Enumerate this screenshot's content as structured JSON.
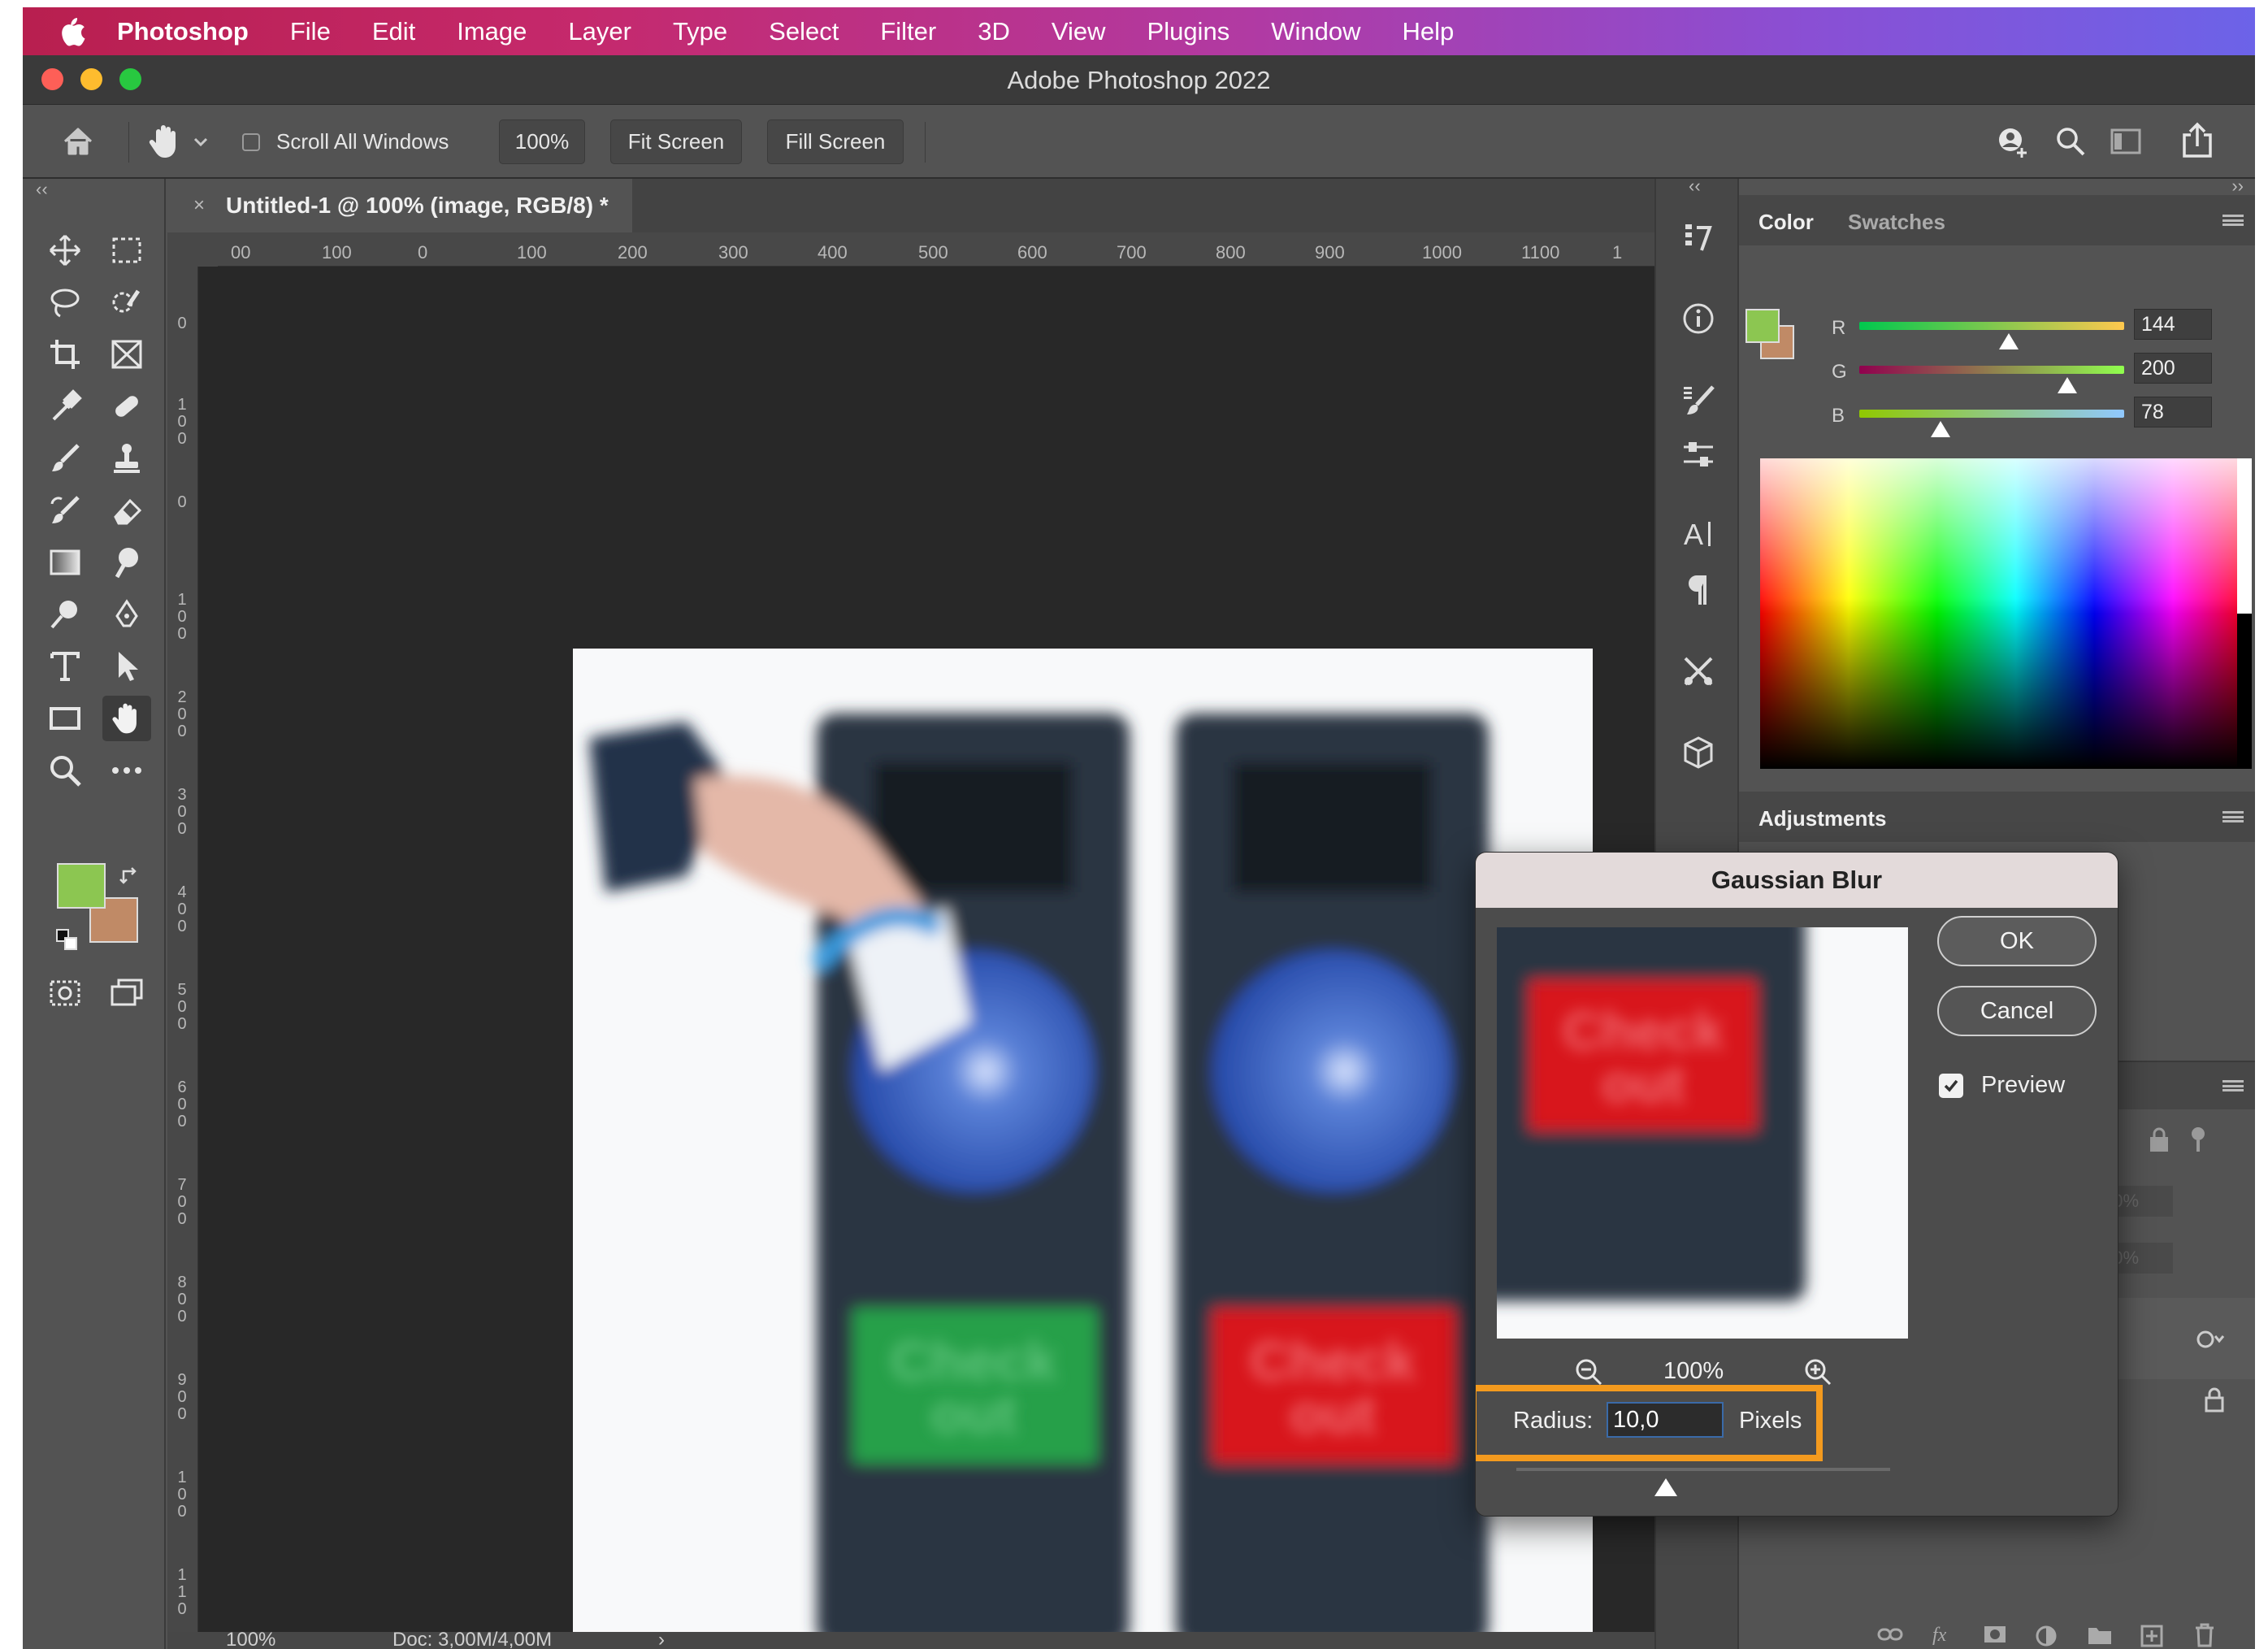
{
  "menubar": {
    "app_name": "Photoshop",
    "items": [
      "File",
      "Edit",
      "Image",
      "Layer",
      "Type",
      "Select",
      "Filter",
      "3D",
      "View",
      "Plugins",
      "Window",
      "Help"
    ]
  },
  "window": {
    "title": "Adobe Photoshop 2022"
  },
  "options_bar": {
    "scroll_all_windows_label": "Scroll All Windows",
    "scroll_all_windows_checked": false,
    "zoom_value": "100%",
    "fit_screen_label": "Fit Screen",
    "fill_screen_label": "Fill Screen"
  },
  "document": {
    "tab_close": "×",
    "tab_title": "Untitled-1 @ 100% (image, RGB/8) *",
    "ruler_h_ticks": [
      "00",
      "100",
      "0",
      "100",
      "200",
      "300",
      "400",
      "500",
      "600",
      "700",
      "800",
      "900",
      "1000",
      "1100",
      "1"
    ],
    "ruler_v_ticks": [
      "0",
      "1\n0\n0",
      "0",
      "1\n0\n0",
      "2\n0\n0",
      "3\n0\n0",
      "4\n0\n0",
      "5\n0\n0",
      "6\n0\n0",
      "7\n0\n0",
      "8\n0\n0",
      "9\n0\n0",
      "1\n0\n0",
      "1\n1\n0"
    ],
    "status_zoom": "100%",
    "status_doc": "Doc: 3,00M/4,00M",
    "status_arrow": "›",
    "image": {
      "left_kiosk_button_text": "Check\nout",
      "right_kiosk_button_text": "Check\nout",
      "left_button_color": "#27a04a",
      "right_button_color": "#d8171e",
      "kiosk_color": "#2a3443",
      "globe_color": "#2c55b0"
    }
  },
  "tools": {
    "foreground_color": "#8cc651",
    "background_color": "#c08a66"
  },
  "color_panel": {
    "tabs": [
      "Color",
      "Swatches"
    ],
    "active_tab": "Color",
    "channels": [
      {
        "label": "R",
        "value": "144",
        "fraction": 0.565
      },
      {
        "label": "G",
        "value": "200",
        "fraction": 0.784
      },
      {
        "label": "B",
        "value": "78",
        "fraction": 0.306
      }
    ]
  },
  "adjustments_panel": {
    "title": "Adjustments"
  },
  "layers_panel": {
    "blurred_values": [
      "00%",
      "00%"
    ]
  },
  "gaussian_blur": {
    "title": "Gaussian Blur",
    "ok_label": "OK",
    "cancel_label": "Cancel",
    "preview_label": "Preview",
    "preview_checked": true,
    "preview_zoom": "100%",
    "preview_button_text": "Check\nout",
    "radius_label": "Radius:",
    "radius_value": "10,0",
    "radius_unit": "Pixels",
    "highlight_color": "#f39a1e"
  }
}
